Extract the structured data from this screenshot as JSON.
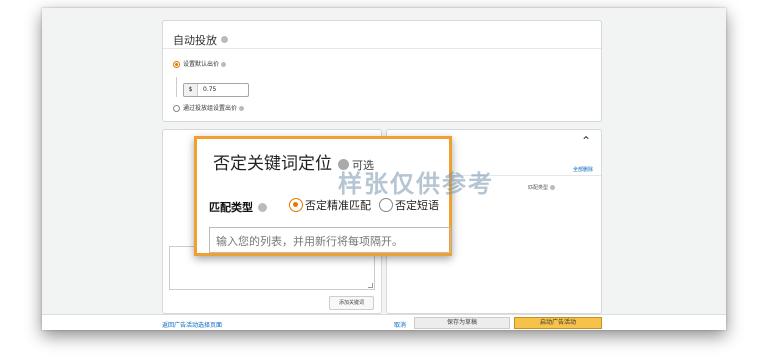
{
  "auto_targeting": {
    "title": "自动投放",
    "default_bid_label": "设置默认出价",
    "currency": "$",
    "default_bid_value": "0.75",
    "group_bid_label": "通过投放组设置出价"
  },
  "negative_targeting": {
    "title": "否定关键词定位",
    "optional": "可选",
    "match_type_label": "匹配类型",
    "options": [
      "否定精准匹配",
      "否定短语"
    ],
    "selected_option": "否定精准匹配",
    "input_placeholder": "输入您的列表，并用新行将每项隔开。",
    "add_keywords_button": "添加关键词",
    "remove_all": "全部删除",
    "match_type_column": "匹配类型"
  },
  "watermark": "样张仅供参考",
  "footer": {
    "back_link": "返回广告活动选择页面",
    "cancel": "取消",
    "save_draft": "保存为草稿",
    "launch": "启动广告活动"
  },
  "colors": {
    "highlight_border": "#f0a030",
    "radio_selected": "#e77600",
    "launch_button": "#f6c24a",
    "link": "#0066c0"
  }
}
